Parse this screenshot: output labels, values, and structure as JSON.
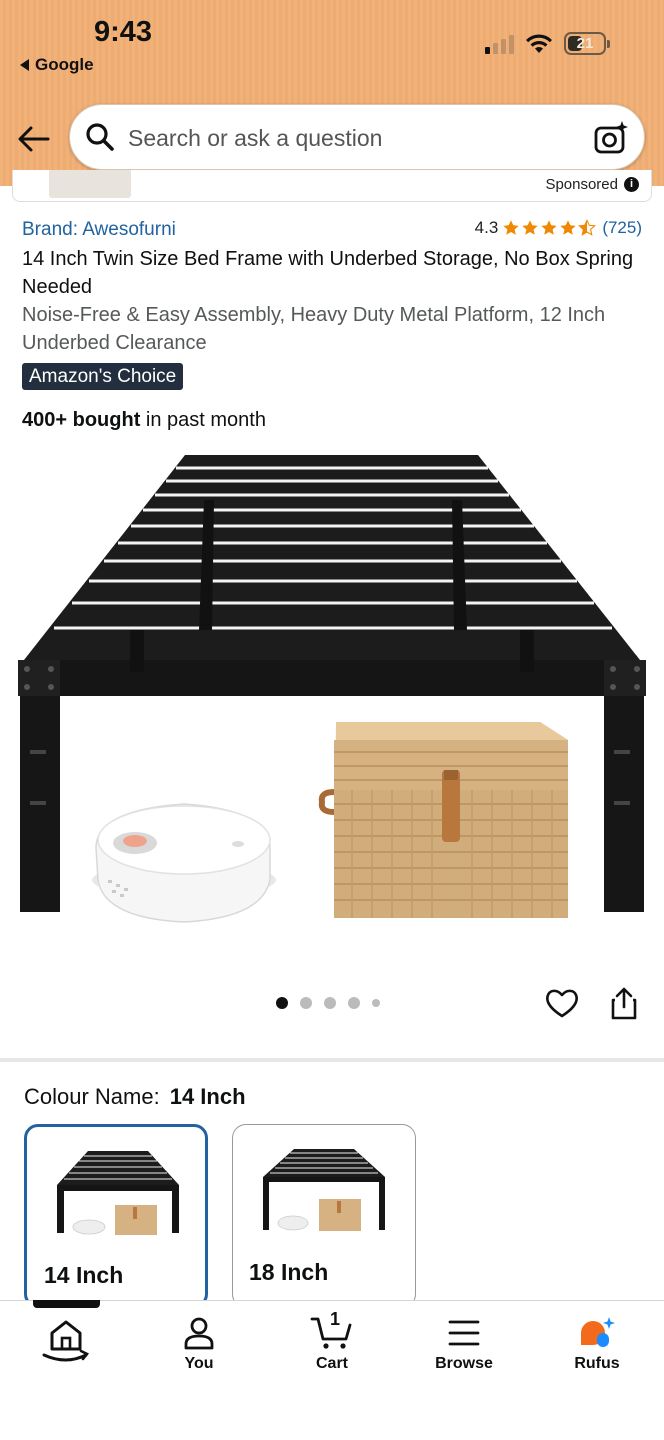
{
  "status_bar": {
    "time": "9:43",
    "back_app": "Google",
    "battery": "21"
  },
  "search": {
    "placeholder": "Search or ask a question"
  },
  "sponsored_strip": {
    "label": "Sponsored"
  },
  "product": {
    "brand": "Brand: Awesofurni",
    "rating_value": "4.3",
    "rating_stars": 4.3,
    "rating_count": "(725)",
    "title": "14 Inch Twin Size Bed Frame with Underbed Storage, No Box Spring Needed",
    "subtitle": "Noise-Free & Easy Assembly, Heavy Duty Metal Platform, 12 Inch Underbed Clearance",
    "badge": "Amazon's Choice",
    "bought_bold": "400+ bought",
    "bought_rest": " in past month",
    "image_count": 5,
    "image_index": 1
  },
  "variation": {
    "label": "Colour Name:",
    "selected": "14 Inch",
    "options": [
      "14 Inch",
      "18 Inch"
    ]
  },
  "nav": {
    "items": [
      "",
      "You",
      "Cart",
      "Browse",
      "Rufus"
    ],
    "cart_count": "1"
  },
  "colors": {
    "header": "#f1b27a",
    "link": "#2162a1",
    "star": "#f08804",
    "badge": "#232f3e"
  }
}
